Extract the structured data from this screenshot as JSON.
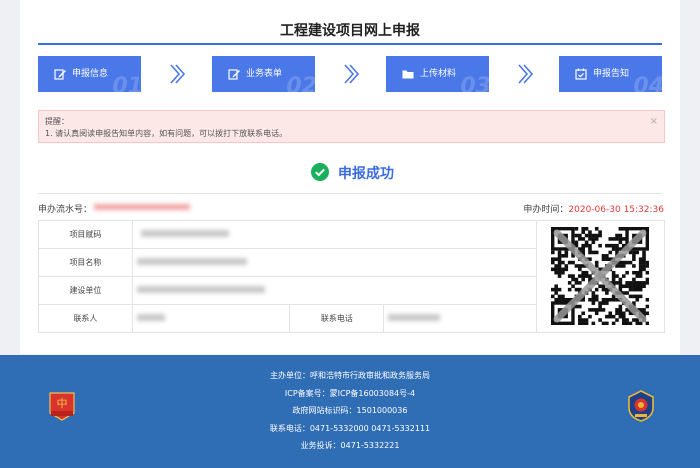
{
  "page": {
    "title": "工程建设项目网上申报"
  },
  "steps": [
    {
      "label": "申报信息",
      "num": "01",
      "icon": "edit-icon"
    },
    {
      "label": "业务表单",
      "num": "02",
      "icon": "edit-icon"
    },
    {
      "label": "上传材料",
      "num": "03",
      "icon": "folder-icon"
    },
    {
      "label": "申报告知",
      "num": "04",
      "icon": "calendar-check-icon"
    }
  ],
  "notice": {
    "heading": "提醒：",
    "text": "1. 请认真阅读申报告知单内容，如有问题，可以拨打下放联系电话。",
    "close": "×"
  },
  "result": {
    "status": "申报成功",
    "icon": "check-circle-icon"
  },
  "meta": {
    "serial_label": "申办流水号：",
    "time_label": "申办时间：",
    "time_value": "2020-06-30 15:32:36"
  },
  "info": {
    "project_code_label": "项目赋码",
    "project_name_label": "项目名称",
    "builder_label": "建设单位",
    "contact_label": "联系人",
    "phone_label": "联系电话"
  },
  "footer": {
    "host": "主办单位：呼和浩特市行政审批和政务服务局",
    "icp": "ICP备案号：蒙ICP备16003084号-4",
    "gov_code": "政府网站标识码：1501000036",
    "phone": "联系电话：0471-5332000 0471-5332111",
    "complaint": "业务投诉：0471-5332221",
    "left_badge": "党政机关",
    "colors": {
      "footer_bg": "#2f6db5",
      "accent": "#3b6de0",
      "step_bg": "#4a78e8",
      "success": "#1aaf5d"
    }
  }
}
